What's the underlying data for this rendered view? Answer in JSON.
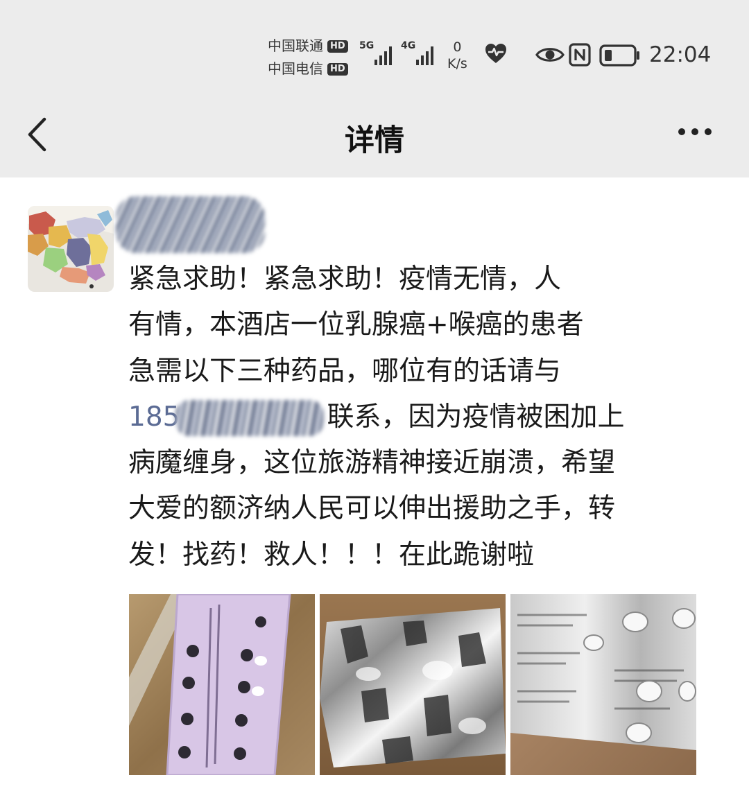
{
  "status_bar": {
    "carrier_1": "中国联通",
    "carrier_2": "中国电信",
    "hd_badge": "HD",
    "network_1": "5G",
    "network_2": "4G",
    "speed_value": "0",
    "speed_unit": "K/s",
    "time": "22:04"
  },
  "title_bar": {
    "title": "详情"
  },
  "post": {
    "lines": [
      "紧急求助！紧急求助！疫情无情，人",
      "有情，本酒店一位乳腺癌+喉癌的患者",
      "急需以下三种药品，哪位有的话请与"
    ],
    "phone_prefix": "185",
    "line4_after_phone": "联系，因为疫情被困加上",
    "lines_rest": [
      "病魔缠身，这位旅游精神接近崩溃，希望",
      "大爱的额济纳人民可以伸出援助之手，转",
      "发！找药！救人！！！在此跪谢啦"
    ]
  },
  "colors": {
    "header_bg": "#ececec",
    "link": "#5b6b94",
    "text": "#1a1a1a"
  }
}
